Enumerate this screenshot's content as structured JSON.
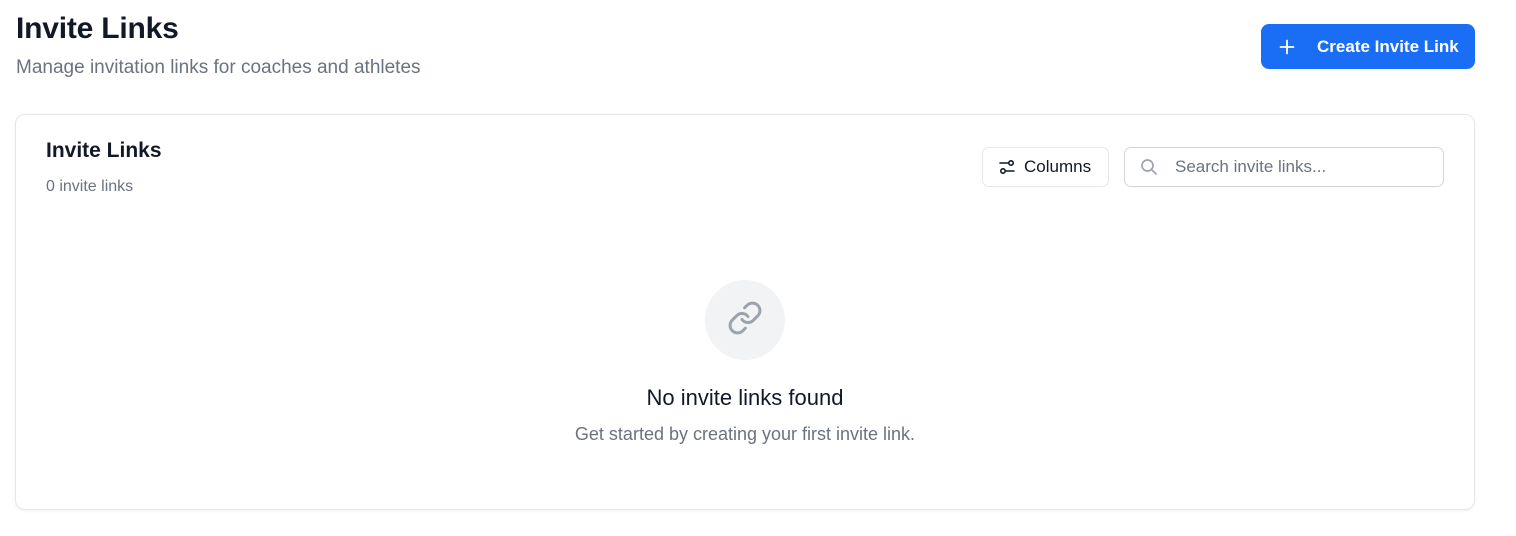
{
  "header": {
    "title": "Invite Links",
    "subtitle": "Manage invitation links for coaches and athletes",
    "create_button_label": "Create Invite Link",
    "create_button_icon": "plus-icon",
    "accent_color": "#1a6ef5"
  },
  "card": {
    "title": "Invite Links",
    "count_text": "0 invite links",
    "columns_button_label": "Columns",
    "columns_button_icon": "sliders-icon",
    "search": {
      "placeholder": "Search invite links...",
      "value": "",
      "icon": "search-icon"
    },
    "empty_state": {
      "icon": "link-icon",
      "title": "No invite links found",
      "description": "Get started by creating your first invite link."
    }
  }
}
